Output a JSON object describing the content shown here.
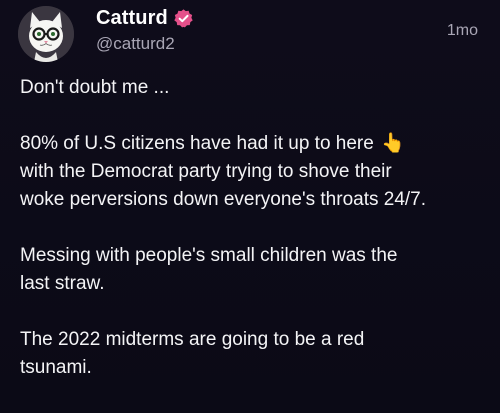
{
  "post": {
    "author": {
      "display_name": "Catturd",
      "handle": "@catturd2",
      "verified_icon": "verified-badge-icon",
      "avatar_icon": "cat-with-glasses-avatar"
    },
    "timestamp": "1mo",
    "paragraphs": [
      "Don't doubt me ...",
      "80% of U.S citizens have had it up to here",
      "with the Democrat party trying to shove their\nwoke perversions down everyone's throats 24/7.",
      "Messing with people's small children was the\nlast straw.",
      "The 2022 midterms are going to be a red\ntsunami."
    ],
    "emoji": "👆",
    "colors": {
      "background": "#0c0a17",
      "verified_badge": "#e4508a",
      "secondary_text": "#a9a6b5"
    }
  }
}
